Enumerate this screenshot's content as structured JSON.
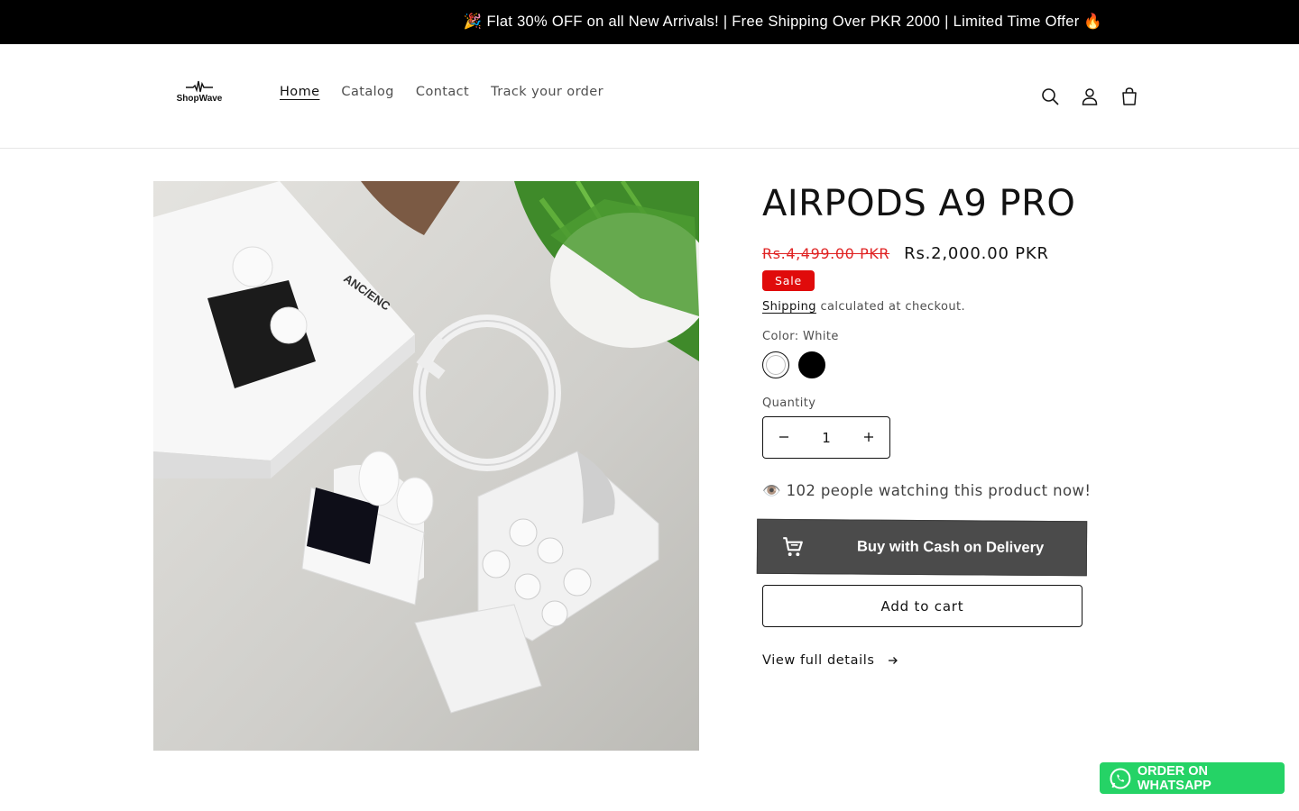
{
  "announcement": "🎉 Flat 30% OFF on all New Arrivals! | Free Shipping Over PKR 2000 | Limited Time Offer 🔥",
  "brand": {
    "name": "ShopWave"
  },
  "nav": [
    {
      "label": "Home",
      "active": true
    },
    {
      "label": "Catalog"
    },
    {
      "label": "Contact"
    },
    {
      "label": "Track your order"
    }
  ],
  "header_icons": [
    "search-icon",
    "account-icon",
    "cart-icon"
  ],
  "product": {
    "title": "AIRPODS A9 PRO",
    "price_old": "Rs.4,499.00 PKR",
    "price_new": "Rs.2,000.00 PKR",
    "badge": "Sale",
    "shipping_link": "Shipping",
    "shipping_rest": " calculated at checkout.",
    "color_label": "Color: White",
    "colors": [
      "White",
      "Black"
    ],
    "quantity_label": "Quantity",
    "quantity": "1",
    "watching": "👁️ 102 people watching this product now!",
    "cod_button": "Buy with Cash on Delivery",
    "add_to_cart": "Add to cart",
    "view_details": "View full details"
  },
  "whatsapp": "ORDER ON WHATSAPP",
  "colors": {
    "sale_red": "#e00b0b",
    "old_price": "#e02424",
    "cod_bg": "#4b4b4b",
    "whatsapp": "#25d366"
  }
}
